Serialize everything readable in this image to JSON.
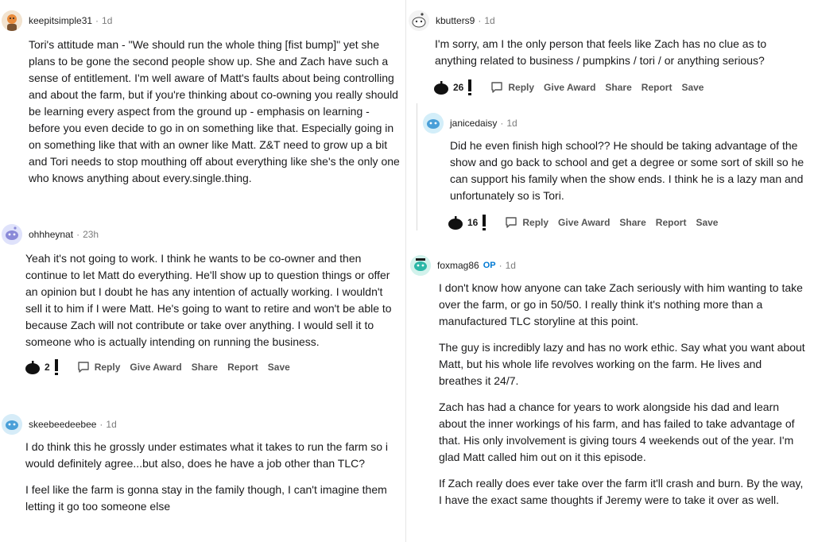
{
  "comments": {
    "keepitsimple": {
      "username": "keepitsimple31",
      "age": "1d",
      "dot": "·",
      "paragraphs": [
        "Tori's attitude man - \"We should run the whole thing [fist bump]\" yet she plans to be gone the second people show up. She and Zach have such a sense of entitlement. I'm well aware of Matt's faults about being controlling and about the farm, but if you're thinking about co-owning you really should be learning every aspect from the ground up - emphasis on learning - before you even decide to go in on something like that. Especially going in on something like that with an owner like Matt. Z&T need to grow up a bit and Tori needs to stop mouthing off about everything like she's the only one who knows anything about every.single.thing."
      ]
    },
    "ohhheynat": {
      "username": "ohhheynat",
      "age": "23h",
      "dot": "·",
      "paragraphs": [
        "Yeah it's not going to work. I think he wants to be co-owner and then continue to let Matt do everything. He'll show up to question things or offer an opinion but I doubt he has any intention of actually working. I wouldn't sell it to him if I were Matt. He's going to want to retire and won't be able to because Zach will not contribute or take over anything. I would sell it to someone who is actually intending on running the business."
      ],
      "score": "2"
    },
    "skeebeedeebee": {
      "username": "skeebeedeebee",
      "age": "1d",
      "dot": "·",
      "paragraphs": [
        "I do think this he grossly under estimates what it takes to run the farm so i would definitely agree...but also, does he have a job other than TLC?",
        "I feel like the farm is gonna stay in the family though, I can't imagine them letting it go too someone else"
      ]
    },
    "kbutters": {
      "username": "kbutters9",
      "age": "1d",
      "dot": "·",
      "paragraphs": [
        "I'm sorry, am I the only person that feels like Zach has no clue as to anything related to business / pumpkins / tori / or anything serious?"
      ],
      "score": "26"
    },
    "janicedaisy": {
      "username": "janicedaisy",
      "age": "1d",
      "dot": "·",
      "paragraphs": [
        "Did he even finish high school?? He should be taking advantage of the show and go back to school and get a degree or some sort of skill so he can support his family when the show ends. I think he is a lazy man and unfortunately so is Tori."
      ],
      "score": "16"
    },
    "foxmag": {
      "username": "foxmag86",
      "op": "OP",
      "age": "1d",
      "dot": "·",
      "paragraphs": [
        "I don't know how anyone can take Zach seriously with him wanting to take over the farm, or go in 50/50. I really think it's nothing more than a manufactured TLC storyline at this point.",
        "The guy is incredibly lazy and has no work ethic. Say what you want about Matt, but his whole life revolves working on the farm. He lives and breathes it 24/7.",
        "Zach has had a chance for years to work alongside his dad and learn about the inner workings of his farm, and has failed to take advantage of that. His only involvement is giving tours 4 weekends out of the year. I'm glad Matt called him out on it this episode.",
        "If Zach really does ever take over the farm it'll crash and burn. By the way, I have the exact same thoughts if Jeremy were to take it over as well."
      ]
    }
  },
  "actions": {
    "reply": "Reply",
    "give_award": "Give Award",
    "share": "Share",
    "report": "Report",
    "save": "Save"
  },
  "icons": {
    "upvote": "pumpkin-upvote-icon",
    "downvote": "downvote-icon",
    "reply": "reply-icon"
  },
  "colors": {
    "avatar_blue": "#4a9fd8",
    "avatar_orange": "#e88a3a",
    "avatar_teal": "#2cb8a8",
    "avatar_purple": "#8a8ad8",
    "op_badge": "#0079d3"
  }
}
